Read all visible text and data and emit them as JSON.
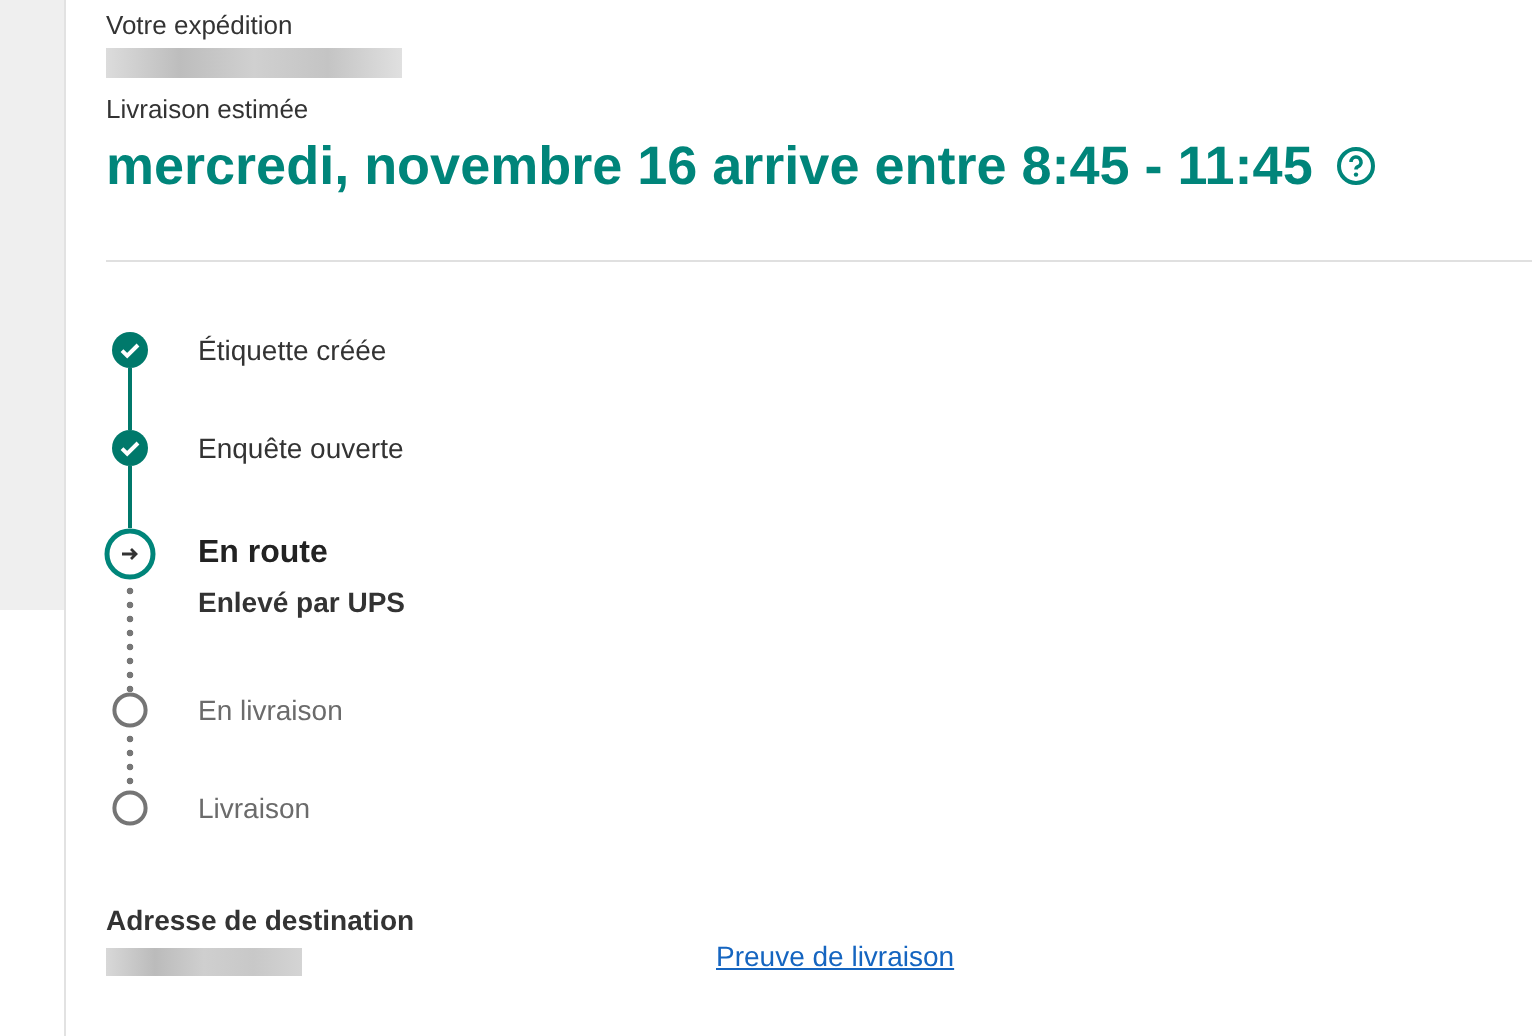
{
  "shipment_label": "Votre expédition",
  "estimate": {
    "label": "Livraison estimée",
    "heading": "mercredi, novembre 16 arrive entre 8:45 - 11:45"
  },
  "steps": [
    {
      "title": "Étiquette créée",
      "kind": "done"
    },
    {
      "title": "Enquête ouverte",
      "kind": "done"
    },
    {
      "title": "En route",
      "kind": "current",
      "subtitle": "Enlevé par UPS"
    },
    {
      "title": "En livraison",
      "kind": "pending"
    },
    {
      "title": "Livraison",
      "kind": "pending"
    }
  ],
  "destination": {
    "label": "Adresse de destination"
  },
  "proof_link": "Preuve de livraison"
}
